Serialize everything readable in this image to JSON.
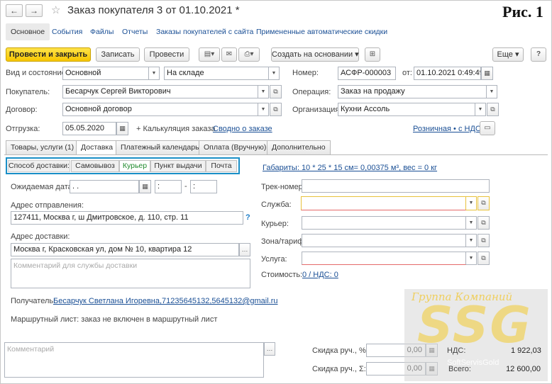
{
  "window": {
    "back_icon": "←",
    "forward_icon": "→",
    "star_icon": "☆",
    "title": "Заказ покупателя 3 от 01.10.2021 *",
    "figure_label": "Рис. 1"
  },
  "top_tabs": [
    "Основное",
    "События",
    "Файлы",
    "Отчеты",
    "Заказы покупателей с сайта",
    "Примененные автоматические скидки"
  ],
  "toolbar": {
    "post_close": "Провести и закрыть",
    "save": "Записать",
    "post": "Провести",
    "create_based": "Создать на основании",
    "more": "Еще"
  },
  "header": {
    "kind_label": "Вид и состояние:",
    "kind_value": "Основной",
    "state_value": "На складе",
    "number_label": "Номер:",
    "number_value": "АСФР-000003",
    "date_from_label": "от:",
    "date_value": "01.10.2021  0:49:49",
    "buyer_label": "Покупатель:",
    "buyer_value": "Бесарчук Сергей Викторович",
    "operation_label": "Операция:",
    "operation_value": "Заказ на продажу",
    "contract_label": "Договор:",
    "contract_value": "Основной договор",
    "org_label": "Организация:",
    "org_value": "Кухни Ассоль",
    "shipment_label": "Отгрузка:",
    "shipment_date": "05.05.2020",
    "calc_link": "+ Калькуляция заказа",
    "summary_link": "Сводно о заказе",
    "price_link": "Розничная • с НДС"
  },
  "doc_tabs": [
    "Товары, услуги (1)",
    "Доставка",
    "Платежный календарь",
    "Оплата (Вручную)",
    "Дополнительно"
  ],
  "delivery": {
    "method_label": "Способ доставки:",
    "methods": [
      "Самовывоз",
      "Курьер",
      "Пункт выдачи",
      "Почта"
    ],
    "selected_method": "Курьер",
    "dimensions_link": "Габариты: 10 * 25 * 15 см= 0,00375 м³, вес = 0 кг",
    "expected_date_label": "Ожидаемая дата:",
    "expected_date_value": ". .",
    "time_from": ":",
    "time_dash": "-",
    "time_to": ":",
    "from_address_label": "Адрес отправления:",
    "from_address_value": "127411, Москва г, ш Дмитровское, д. 110, стр. 11",
    "help_mark": "?",
    "to_address_label": "Адрес доставки:",
    "to_address_value": "Москва г, Красковская ул, дом № 10, квартира 12",
    "comment_placeholder": "Комментарий для службы доставки",
    "recipient_label": "Получатель:",
    "recipient_value": "Бесарчук Светлана Игоревна,71235645132,5645132@gmail.ru",
    "route_text": "Маршрутный лист: заказ не включен в маршрутный лист",
    "track_label": "Трек-номер:",
    "service_label": "Служба:",
    "courier_label": "Курьер:",
    "zone_label": "Зона/тариф:",
    "svc_label": "Услуга:",
    "cost_label": "Стоимость:",
    "cost_value": "0 / НДС: 0"
  },
  "footer": {
    "comment_placeholder": "Комментарий",
    "discount_pct_label": "Скидка руч., %:",
    "discount_pct_value": "0,00",
    "discount_sum_label": "Скидка руч., Σ:",
    "discount_sum_value": "0,00",
    "vat_label": "НДС:",
    "vat_value": "1 922,03",
    "total_label": "Всего:",
    "total_value": "12 600,00"
  },
  "watermark": {
    "top": "Группа Компаний",
    "big": "SSG",
    "bottom": "SoftServisGold"
  },
  "colors": {
    "primary_button": "#f7c600",
    "link": "#1a4f95",
    "highlight_box": "#1a8fc7",
    "selected_method": "#1f8a2d"
  }
}
